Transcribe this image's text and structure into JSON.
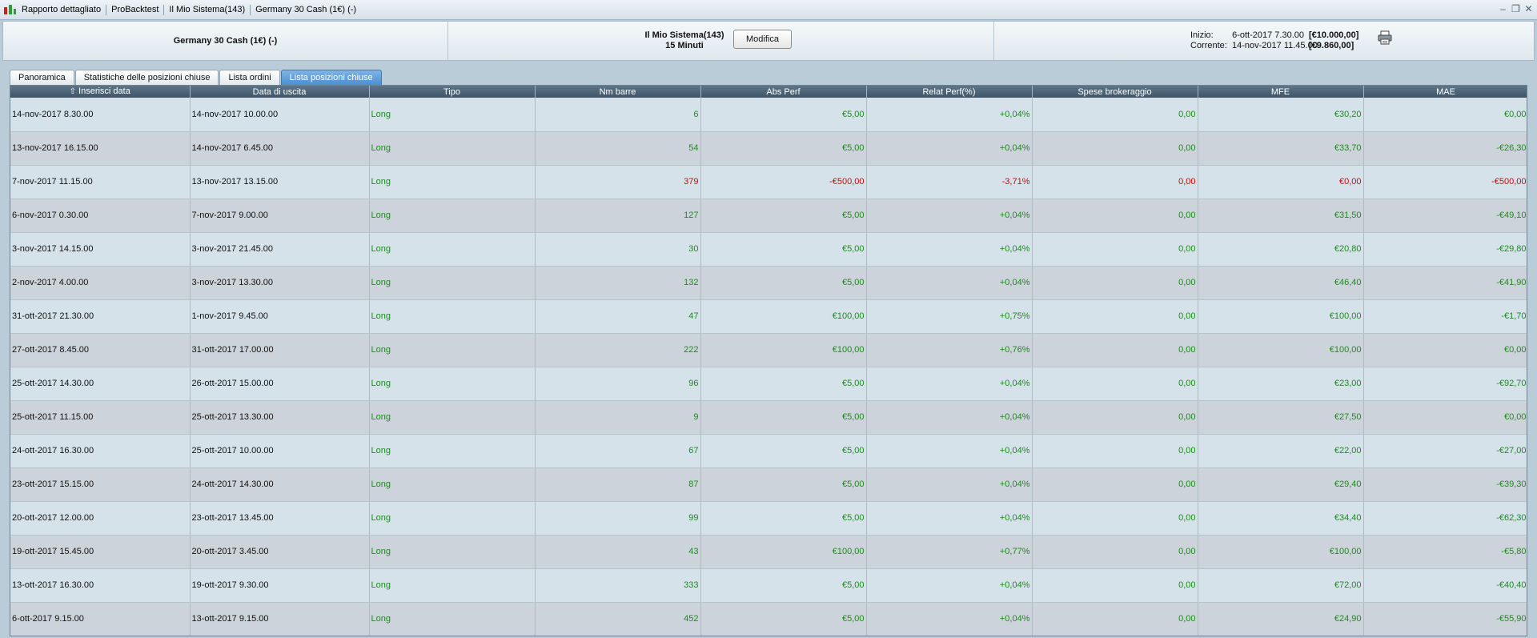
{
  "titlebar": {
    "crumbs": [
      "Rapporto dettagliato",
      "ProBacktest",
      "Il Mio Sistema(143)",
      "Germany 30 Cash (1€) (-)"
    ]
  },
  "header": {
    "instrument": "Germany 30 Cash (1€) (-)",
    "system_name": "Il Mio Sistema(143)",
    "timeframe": "15 Minuti",
    "modify_label": "Modifica",
    "start_label": "Inizio:",
    "start_date": "6-ott-2017 7.30.00",
    "start_balance": "[€10.000,00]",
    "current_label": "Corrente:",
    "current_date": "14-nov-2017 11.45.00",
    "current_balance": "[€9.860,00]"
  },
  "tabs": [
    {
      "label": "Panoramica",
      "active": false
    },
    {
      "label": "Statistiche delle posizioni chiuse",
      "active": false
    },
    {
      "label": "Lista ordini",
      "active": false
    },
    {
      "label": "Lista posizioni chiuse",
      "active": true
    }
  ],
  "colors": {
    "positive": "#1f8a1f",
    "negative": "#c40e0e",
    "active_tab": "#4d8fd0"
  },
  "table": {
    "columns": [
      "Inserisci data",
      "Data di uscita",
      "Tipo",
      "Nm barre",
      "Abs Perf",
      "Relat Perf(%)",
      "Spese brokeraggio",
      "MFE",
      "MAE"
    ],
    "sort_icon": "sort-up-arrow-icon",
    "rows": [
      {
        "entry": "14-nov-2017 8.30.00",
        "exit": "14-nov-2017 10.00.00",
        "type": "Long",
        "bars": "6",
        "abs": "€5,00",
        "rel": "+0,04%",
        "fees": "0,00",
        "mfe": "€30,20",
        "mae": "€0,00",
        "loss": false
      },
      {
        "entry": "13-nov-2017 16.15.00",
        "exit": "14-nov-2017 6.45.00",
        "type": "Long",
        "bars": "54",
        "abs": "€5,00",
        "rel": "+0,04%",
        "fees": "0,00",
        "mfe": "€33,70",
        "mae": "-€26,30",
        "loss": false
      },
      {
        "entry": "7-nov-2017 11.15.00",
        "exit": "13-nov-2017 13.15.00",
        "type": "Long",
        "bars": "379",
        "abs": "-€500,00",
        "rel": "-3,71%",
        "fees": "0,00",
        "mfe": "€0,00",
        "mae": "-€500,00",
        "loss": true
      },
      {
        "entry": "6-nov-2017 0.30.00",
        "exit": "7-nov-2017 9.00.00",
        "type": "Long",
        "bars": "127",
        "abs": "€5,00",
        "rel": "+0,04%",
        "fees": "0,00",
        "mfe": "€31,50",
        "mae": "-€49,10",
        "loss": false
      },
      {
        "entry": "3-nov-2017 14.15.00",
        "exit": "3-nov-2017 21.45.00",
        "type": "Long",
        "bars": "30",
        "abs": "€5,00",
        "rel": "+0,04%",
        "fees": "0,00",
        "mfe": "€20,80",
        "mae": "-€29,80",
        "loss": false
      },
      {
        "entry": "2-nov-2017 4.00.00",
        "exit": "3-nov-2017 13.30.00",
        "type": "Long",
        "bars": "132",
        "abs": "€5,00",
        "rel": "+0,04%",
        "fees": "0,00",
        "mfe": "€46,40",
        "mae": "-€41,90",
        "loss": false
      },
      {
        "entry": "31-ott-2017 21.30.00",
        "exit": "1-nov-2017 9.45.00",
        "type": "Long",
        "bars": "47",
        "abs": "€100,00",
        "rel": "+0,75%",
        "fees": "0,00",
        "mfe": "€100,00",
        "mae": "-€1,70",
        "loss": false
      },
      {
        "entry": "27-ott-2017 8.45.00",
        "exit": "31-ott-2017 17.00.00",
        "type": "Long",
        "bars": "222",
        "abs": "€100,00",
        "rel": "+0,76%",
        "fees": "0,00",
        "mfe": "€100,00",
        "mae": "€0,00",
        "loss": false
      },
      {
        "entry": "25-ott-2017 14.30.00",
        "exit": "26-ott-2017 15.00.00",
        "type": "Long",
        "bars": "96",
        "abs": "€5,00",
        "rel": "+0,04%",
        "fees": "0,00",
        "mfe": "€23,00",
        "mae": "-€92,70",
        "loss": false
      },
      {
        "entry": "25-ott-2017 11.15.00",
        "exit": "25-ott-2017 13.30.00",
        "type": "Long",
        "bars": "9",
        "abs": "€5,00",
        "rel": "+0,04%",
        "fees": "0,00",
        "mfe": "€27,50",
        "mae": "€0,00",
        "loss": false
      },
      {
        "entry": "24-ott-2017 16.30.00",
        "exit": "25-ott-2017 10.00.00",
        "type": "Long",
        "bars": "67",
        "abs": "€5,00",
        "rel": "+0,04%",
        "fees": "0,00",
        "mfe": "€22,00",
        "mae": "-€27,00",
        "loss": false
      },
      {
        "entry": "23-ott-2017 15.15.00",
        "exit": "24-ott-2017 14.30.00",
        "type": "Long",
        "bars": "87",
        "abs": "€5,00",
        "rel": "+0,04%",
        "fees": "0,00",
        "mfe": "€29,40",
        "mae": "-€39,30",
        "loss": false
      },
      {
        "entry": "20-ott-2017 12.00.00",
        "exit": "23-ott-2017 13.45.00",
        "type": "Long",
        "bars": "99",
        "abs": "€5,00",
        "rel": "+0,04%",
        "fees": "0,00",
        "mfe": "€34,40",
        "mae": "-€62,30",
        "loss": false
      },
      {
        "entry": "19-ott-2017 15.45.00",
        "exit": "20-ott-2017 3.45.00",
        "type": "Long",
        "bars": "43",
        "abs": "€100,00",
        "rel": "+0,77%",
        "fees": "0,00",
        "mfe": "€100,00",
        "mae": "-€5,80",
        "loss": false
      },
      {
        "entry": "13-ott-2017 16.30.00",
        "exit": "19-ott-2017 9.30.00",
        "type": "Long",
        "bars": "333",
        "abs": "€5,00",
        "rel": "+0,04%",
        "fees": "0,00",
        "mfe": "€72,00",
        "mae": "-€40,40",
        "loss": false
      },
      {
        "entry": "6-ott-2017 9.15.00",
        "exit": "13-ott-2017 9.15.00",
        "type": "Long",
        "bars": "452",
        "abs": "€5,00",
        "rel": "+0,04%",
        "fees": "0,00",
        "mfe": "€24,90",
        "mae": "-€55,90",
        "loss": false
      }
    ]
  }
}
